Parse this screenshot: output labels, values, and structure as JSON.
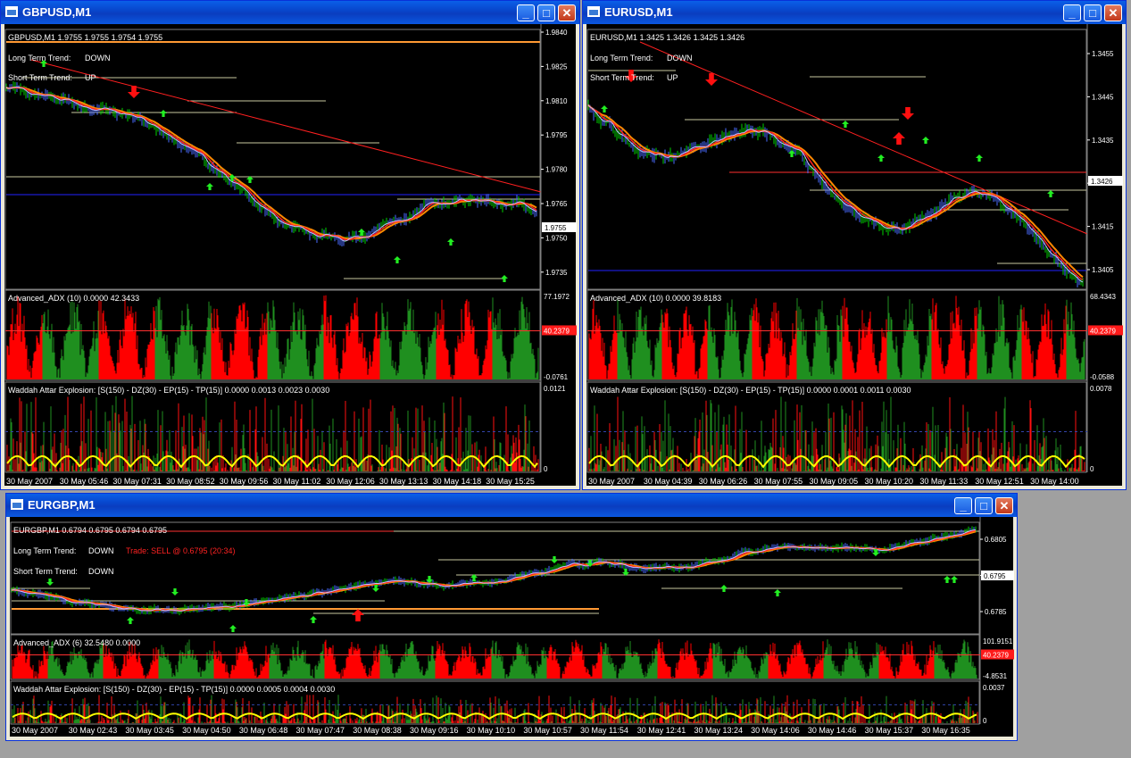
{
  "windows": [
    {
      "id": "gbp",
      "title": "GBPUSD,M1",
      "header": "GBPUSD,M1  1.9755 1.9755 1.9754 1.9755",
      "long_term_label": "Long Term Trend:",
      "long_term_value": "DOWN",
      "short_term_label": "Short Term Trend:",
      "short_term_value": "UP",
      "trade_text": "",
      "price_labels": [
        "1.9840",
        "1.9825",
        "1.9810",
        "1.9795",
        "1.9780",
        "1.9765",
        "1.9750",
        "1.9735"
      ],
      "current_price": "1.9755",
      "adx_title": "Advanced_ADX (10) 0.0000 42.3433",
      "adx_labels": [
        "77.1972",
        "40.2379",
        "-0.0761"
      ],
      "wae_title": "Waddah Attar Explosion: [S(150) - DZ(30) - EP(15) - TP(15)] 0.0000 0.0013 0.0023 0.0030",
      "wae_labels": [
        "0.0121",
        "0"
      ],
      "time_labels": [
        "30 May 2007",
        "30 May 05:46",
        "30 May 07:31",
        "30 May 08:52",
        "30 May 09:56",
        "30 May 11:02",
        "30 May 12:06",
        "30 May 13:13",
        "30 May 14:18",
        "30 May 15:25"
      ]
    },
    {
      "id": "eur",
      "title": "EURUSD,M1",
      "header": "EURUSD,M1  1.3425 1.3426 1.3425 1.3426",
      "long_term_label": "Long Term Trend:",
      "long_term_value": "DOWN",
      "short_term_label": "Short Term Trend:",
      "short_term_value": "UP",
      "trade_text": "",
      "price_labels": [
        "1.3455",
        "1.3445",
        "1.3435",
        "1.3425",
        "1.3415",
        "1.3405"
      ],
      "current_price": "1.3426",
      "adx_title": "Advanced_ADX (10) 0.0000 39.8183",
      "adx_labels": [
        "68.4343",
        "40.2379",
        "-0.0588"
      ],
      "wae_title": "Waddah Attar Explosion: [S(150) - DZ(30) - EP(15) - TP(15)] 0.0000 0.0001 0.0011 0.0030",
      "wae_labels": [
        "0.0078",
        "0"
      ],
      "time_labels": [
        "30 May 2007",
        "30 May 04:39",
        "30 May 06:26",
        "30 May 07:55",
        "30 May 09:05",
        "30 May 10:20",
        "30 May 11:33",
        "30 May 12:51",
        "30 May 14:00"
      ]
    },
    {
      "id": "egb",
      "title": "EURGBP,M1",
      "header": "EURGBP,M1  0.6794 0.6795 0.6794 0.6795",
      "long_term_label": "Long Term Trend:",
      "long_term_value": "DOWN",
      "short_term_label": "Short Term Trend:",
      "short_term_value": "DOWN",
      "trade_text": "Trade: SELL @ 0.6795 (20:34)",
      "price_labels": [
        "0.6805",
        "0.6795",
        "0.6785"
      ],
      "current_price": "0.6795",
      "adx_title": "Advanced_ADX (6) 32.5480 0.0000",
      "adx_labels": [
        "101.9151",
        "40.2379",
        "-4.8531"
      ],
      "wae_title": "Waddah Attar Explosion: [S(150) - DZ(30) - EP(15) - TP(15)] 0.0000 0.0005 0.0004 0.0030",
      "wae_labels": [
        "0.0037",
        "0"
      ],
      "time_labels": [
        "30 May 2007",
        "30 May 02:43",
        "30 May 03:45",
        "30 May 04:50",
        "30 May 06:48",
        "30 May 07:47",
        "30 May 08:38",
        "30 May 09:16",
        "30 May 10:10",
        "30 May 10:57",
        "30 May 11:54",
        "30 May 12:41",
        "30 May 13:24",
        "30 May 14:06",
        "30 May 14:46",
        "30 May 15:37",
        "30 May 16:35"
      ]
    }
  ],
  "colors": {
    "background": "#000000",
    "trend_red": "#ff2020",
    "trend_blue": "#1a1aff",
    "support_orange": "#ff9933",
    "adx_red": "#ff0000",
    "adx_green": "#1f8f1f",
    "wae_yellow": "#ffff00",
    "grid_line": "#c8c8a0",
    "price_line": "#9999ff"
  }
}
